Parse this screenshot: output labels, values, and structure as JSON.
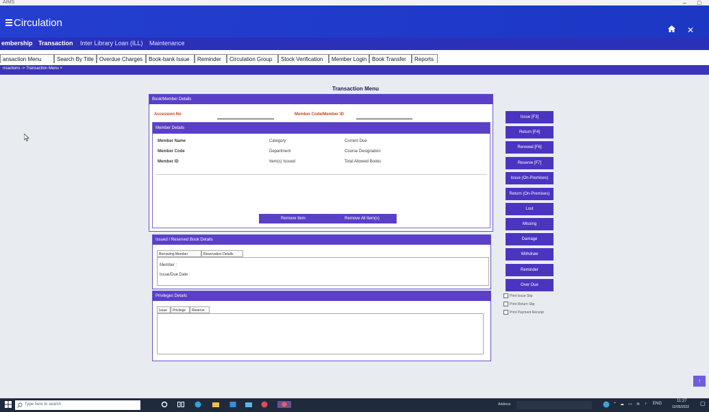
{
  "window": {
    "title": "AIMS",
    "minimize": "–",
    "maximize": "□"
  },
  "app": {
    "title": "Circulation",
    "home_icon": "home-icon",
    "close_icon": "close-icon"
  },
  "menubar": {
    "items": [
      "embership",
      "Transaction",
      "Inter Library Loan (ILL)",
      "Maintenance"
    ],
    "active": "Transaction"
  },
  "tabs": [
    "ansaction Menu",
    "Search By Title",
    "Overdue Charges",
    "Book-bank Issue",
    "Reminder",
    "Circulation Group",
    "Stock Verification",
    "Member Login",
    "Book Transfer",
    "Reports"
  ],
  "breadcrumb": "nsactions ->  Transaction Menu  ×",
  "page_title": "Transaction Menu",
  "book_member": {
    "header": "Book/Member Details",
    "accession_label": "Accession No",
    "member_code_label": "Member Code/Member ID",
    "member_details": {
      "header": "Member Details",
      "fields": [
        "Member Name",
        "Member Code",
        "Member ID"
      ],
      "fields2": [
        "Category",
        "Department",
        "Item(s) Issued"
      ],
      "fields3": [
        "Current Due",
        "Course Designation",
        "Total Allowed Books"
      ]
    },
    "remove_item": "Remove Item",
    "remove_all": "Remove All Item(s)"
  },
  "issued": {
    "header": "Issued / Reserved Book Details",
    "tabs": [
      "Borrowing Member",
      "Reservation Details"
    ],
    "member_label": "Member :",
    "issue_due_label": "Issue/Due Date :"
  },
  "privileges": {
    "header": "Privileges Details",
    "tabs": [
      "Issue",
      "Privilege",
      "Reserve"
    ]
  },
  "side_buttons": [
    "Issue [F3]",
    "Return [F4]",
    "Renewal [F6]",
    "Reserve [F7]",
    "Issue (On-Premises)",
    "Return (On-Premises)",
    "Lost",
    "Missing",
    "Damage",
    "Withdraw",
    "Reminder",
    "Over Due"
  ],
  "checkboxes": [
    "Print Issue Slip",
    "Print Return Slip",
    "Print Payment Receipt"
  ],
  "taskbar": {
    "search_placeholder": "Type here to search",
    "address_label": "Address",
    "lang": "ENG",
    "time": "11:27",
    "date": "12/05/2022"
  },
  "colors": {
    "titlebar": "#243fd0",
    "menubar": "#2c2fb8",
    "accent": "#5a3fc8",
    "button": "#4a34c0"
  }
}
